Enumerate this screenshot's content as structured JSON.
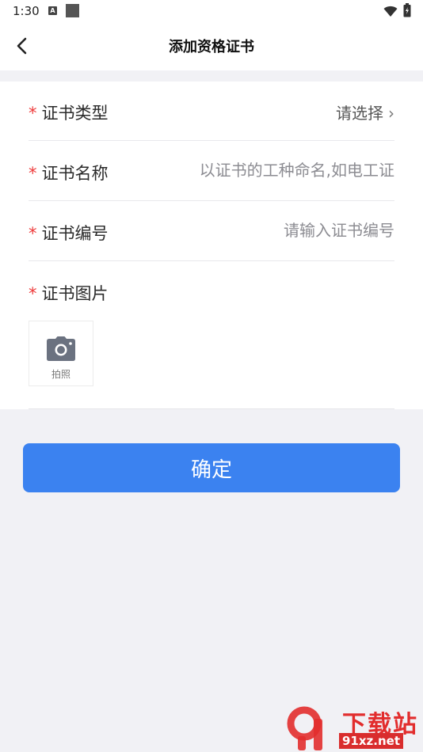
{
  "status_bar": {
    "time": "1:30",
    "notif_badge": "A"
  },
  "header": {
    "title": "添加资格证书"
  },
  "form": {
    "required_mark": "*",
    "cert_type": {
      "label": "证书类型",
      "value": "请选择",
      "chevron": "›"
    },
    "cert_name": {
      "label": "证书名称",
      "placeholder": "以证书的工种命名,如电工证"
    },
    "cert_number": {
      "label": "证书编号",
      "placeholder": "请输入证书编号"
    },
    "cert_image": {
      "label": "证书图片",
      "photo_label": "拍照"
    }
  },
  "actions": {
    "confirm_label": "确定"
  },
  "watermark": {
    "title": "下载站",
    "url": "91xz.net"
  },
  "colors": {
    "primary": "#3b82f0",
    "required": "#ee3b3b",
    "background": "#f1f1f5"
  },
  "icons": [
    "back-icon",
    "camera-icon",
    "wifi-icon",
    "battery-icon"
  ]
}
